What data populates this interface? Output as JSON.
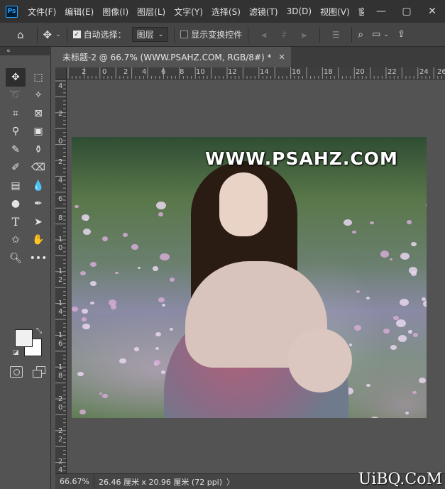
{
  "app": {
    "logo_text": "Ps",
    "menus": [
      "文件(F)",
      "编辑(E)",
      "图像(I)",
      "图层(L)",
      "文字(Y)",
      "选择(S)",
      "滤镜(T)",
      "3D(D)",
      "视图(V)",
      "窗口(W"
    ],
    "window_controls": {
      "minimize": "—",
      "restore": "▢",
      "close": "✕"
    }
  },
  "options_bar": {
    "auto_select_label": "自动选择：",
    "auto_select_checked": true,
    "auto_select_target": "图层",
    "show_transform_label": "显示变换控件",
    "show_transform_checked": false
  },
  "panel_collapse_label": "«",
  "document": {
    "tab_title": "未标题-2 @ 66.7% (WWW.PSAHZ.COM, RGB/8#) *",
    "tab_close": "✕",
    "ruler_h_labels": [
      "2",
      "0",
      "2",
      "4",
      "6",
      "8",
      "10",
      "12",
      "14",
      "16",
      "18",
      "20",
      "22",
      "24",
      "26"
    ],
    "ruler_v_labels": [
      "4",
      "2",
      "0",
      "2",
      "4",
      "6",
      "8",
      "1",
      "0",
      "1",
      "2",
      "1",
      "4",
      "1",
      "6",
      "1",
      "8",
      "2",
      "0",
      "2",
      "2",
      "2",
      "4"
    ],
    "watermark_text": "WWW.PSAHZ.COM"
  },
  "status_bar": {
    "zoom": "66.67%",
    "doc_info": "26.46 厘米 x 20.96 厘米 (72 ppi)",
    "arrow": "〉"
  },
  "site_watermark": "UiBQ.CoM",
  "colors": {
    "foreground": "#f0f0f0",
    "background": "#ffffff",
    "accent": "#31a8ff"
  }
}
